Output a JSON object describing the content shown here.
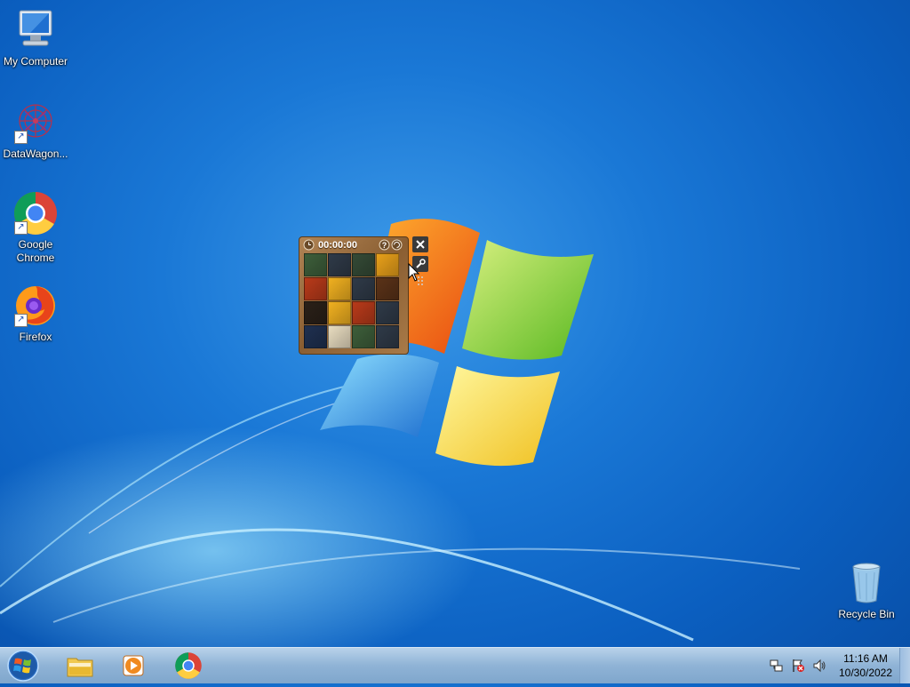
{
  "desktop": {
    "icons": [
      {
        "label": "My Computer",
        "icon": "computer-icon"
      },
      {
        "label": "DataWagon...",
        "icon": "datawagon-icon"
      },
      {
        "label": "Google Chrome",
        "icon": "chrome-icon"
      },
      {
        "label": "Firefox",
        "icon": "firefox-icon"
      },
      {
        "label": "Recycle Bin",
        "icon": "recycle-bin-icon"
      }
    ]
  },
  "gadget": {
    "timer": "00:00:00",
    "help_icon": "help-icon",
    "shuffle_icon": "shuffle-icon",
    "close_icon": "close-icon",
    "options_icon": "wrench-icon",
    "tile_colors": [
      "#3d5e3a",
      "#2f3a48",
      "#344a36",
      "#e8a01a",
      "#b83a1a",
      "#f0b020",
      "#2f3a48",
      "#5a3218",
      "#2a2018",
      "#f0b020",
      "#b83a1a",
      "#2f3a48",
      "#1f3050",
      "#e8dcc0",
      "#3d5e3a",
      "#2f3a48"
    ]
  },
  "taskbar": {
    "start_icon": "windows-start-icon",
    "items": [
      {
        "name": "explorer",
        "icon": "folder-icon"
      },
      {
        "name": "media-player",
        "icon": "media-player-icon"
      },
      {
        "name": "chrome",
        "icon": "chrome-icon"
      }
    ],
    "tray_icons": [
      "network-icon",
      "action-center-icon",
      "volume-icon"
    ],
    "time": "11:16 AM",
    "date": "10/30/2022"
  }
}
